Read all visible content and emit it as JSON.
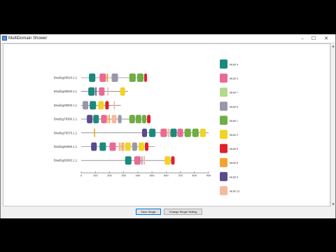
{
  "window": {
    "title": "MultiDomain Shower",
    "controls": {
      "minimize": "–",
      "maximize": "☐",
      "close": "✕"
    }
  },
  "buttons": {
    "save": "Save Single",
    "change": "Change Single Setting"
  },
  "colors": {
    "Motif 4": "#1b8a7d",
    "Motif 3": "#ea6a94",
    "Motif 7": "#b2d98c",
    "Motif 6": "#9a96aa",
    "Motif 1": "#6fad45",
    "Motif 2": "#f0d424",
    "Motif 5": "#e0202c",
    "Motif 8": "#f2a32f",
    "Motif 9": "#5b4a8c",
    "Motif 10": "#f5b99f"
  },
  "chart_data": {
    "type": "motif-map",
    "x_range": [
      0,
      900
    ],
    "x_ticks": [
      "0",
      "100",
      "200",
      "300",
      "400",
      "500",
      "600",
      "700",
      "800",
      "900"
    ],
    "legend": [
      {
        "label": "Motif 4",
        "color": "#1b8a7d"
      },
      {
        "label": "Motif 3",
        "color": "#ea6a94"
      },
      {
        "label": "Motif 7",
        "color": "#b2d98c"
      },
      {
        "label": "Motif 6",
        "color": "#9a96aa"
      },
      {
        "label": "Motif 1",
        "color": "#6fad45"
      },
      {
        "label": "Motif 2",
        "color": "#f0d424"
      },
      {
        "label": "Motif 5",
        "color": "#e0202c"
      },
      {
        "label": "Motif 8",
        "color": "#f2a32f"
      },
      {
        "label": "Motif 9",
        "color": "#5b4a8c"
      },
      {
        "label": "Motif 10",
        "color": "#f5b99f"
      }
    ],
    "sequences": [
      {
        "id": "Bradi1g00610.2.1",
        "length": 450,
        "motifs": [
          {
            "motif": "Motif 4",
            "start": 55,
            "end": 100
          },
          {
            "motif": "Motif 3",
            "start": 130,
            "end": 175
          },
          {
            "motif": "Motif 8",
            "start": 180,
            "end": 190
          },
          {
            "motif": "Motif 6",
            "start": 215,
            "end": 260
          },
          {
            "motif": "Motif 1",
            "start": 340,
            "end": 385
          },
          {
            "motif": "Motif 1",
            "start": 395,
            "end": 440
          },
          {
            "motif": "Motif 5",
            "start": 445,
            "end": 465
          }
        ]
      },
      {
        "id": "Bradi1g00840.2.1",
        "length": 330,
        "motifs": [
          {
            "motif": "Motif 4",
            "start": 50,
            "end": 95
          },
          {
            "motif": "Motif 9",
            "start": 100,
            "end": 108
          },
          {
            "motif": "Motif 3",
            "start": 125,
            "end": 165
          },
          {
            "motif": "Motif 10",
            "start": 185,
            "end": 192
          },
          {
            "motif": "Motif 2",
            "start": 275,
            "end": 310
          }
        ]
      },
      {
        "id": "Bradi1g00900.1.1",
        "length": 280,
        "motifs": [
          {
            "motif": "Motif 6",
            "start": 10,
            "end": 50
          },
          {
            "motif": "Motif 4",
            "start": 60,
            "end": 105
          },
          {
            "motif": "Motif 2",
            "start": 120,
            "end": 160
          },
          {
            "motif": "Motif 5",
            "start": 170,
            "end": 195
          },
          {
            "motif": "Motif 10",
            "start": 230,
            "end": 236
          }
        ]
      },
      {
        "id": "Bradi1g76360.1.1",
        "length": 470,
        "motifs": [
          {
            "motif": "Motif 9",
            "start": 40,
            "end": 80
          },
          {
            "motif": "Motif 4",
            "start": 85,
            "end": 125
          },
          {
            "motif": "Motif 3",
            "start": 140,
            "end": 180
          },
          {
            "motif": "Motif 10",
            "start": 180,
            "end": 190
          },
          {
            "motif": "Motif 8",
            "start": 195,
            "end": 202
          },
          {
            "motif": "Motif 10",
            "start": 215,
            "end": 250
          },
          {
            "motif": "Motif 6",
            "start": 260,
            "end": 285
          },
          {
            "motif": "Motif 1",
            "start": 340,
            "end": 380
          },
          {
            "motif": "Motif 1",
            "start": 385,
            "end": 425
          },
          {
            "motif": "Motif 1",
            "start": 430,
            "end": 460
          },
          {
            "motif": "Motif 5",
            "start": 465,
            "end": 490
          }
        ]
      },
      {
        "id": "Bradi1g76370.1.1",
        "length": 900,
        "motifs": [
          {
            "motif": "Motif 8",
            "start": 90,
            "end": 97
          },
          {
            "motif": "Motif 9",
            "start": 430,
            "end": 465
          },
          {
            "motif": "Motif 4",
            "start": 480,
            "end": 525
          },
          {
            "motif": "Motif 3",
            "start": 560,
            "end": 605
          },
          {
            "motif": "Motif 10",
            "start": 610,
            "end": 625
          },
          {
            "motif": "Motif 4",
            "start": 630,
            "end": 675
          },
          {
            "motif": "Motif 3",
            "start": 680,
            "end": 720
          },
          {
            "motif": "Motif 1",
            "start": 730,
            "end": 775
          },
          {
            "motif": "Motif 1",
            "start": 785,
            "end": 830
          },
          {
            "motif": "Motif 2",
            "start": 840,
            "end": 880
          }
        ]
      },
      {
        "id": "Bradi1g82960.1.1",
        "length": 520,
        "motifs": [
          {
            "motif": "Motif 9",
            "start": 70,
            "end": 110
          },
          {
            "motif": "Motif 4",
            "start": 130,
            "end": 175
          },
          {
            "motif": "Motif 3",
            "start": 200,
            "end": 245
          },
          {
            "motif": "Motif 10",
            "start": 265,
            "end": 280
          },
          {
            "motif": "Motif 8",
            "start": 285,
            "end": 295
          },
          {
            "motif": "Motif 10",
            "start": 295,
            "end": 305
          },
          {
            "motif": "Motif 2",
            "start": 310,
            "end": 350
          },
          {
            "motif": "Motif 6",
            "start": 360,
            "end": 395
          },
          {
            "motif": "Motif 2",
            "start": 405,
            "end": 445
          },
          {
            "motif": "Motif 5",
            "start": 450,
            "end": 475
          }
        ]
      },
      {
        "id": "Bradi1g82962.1.1",
        "length": 650,
        "motifs": [
          {
            "motif": "Motif 4",
            "start": 310,
            "end": 355
          },
          {
            "motif": "Motif 3",
            "start": 375,
            "end": 420
          },
          {
            "motif": "Motif 6",
            "start": 425,
            "end": 432
          },
          {
            "motif": "Motif 10",
            "start": 440,
            "end": 450
          },
          {
            "motif": "Motif 2",
            "start": 590,
            "end": 630
          },
          {
            "motif": "Motif 5",
            "start": 635,
            "end": 660
          }
        ]
      }
    ]
  }
}
